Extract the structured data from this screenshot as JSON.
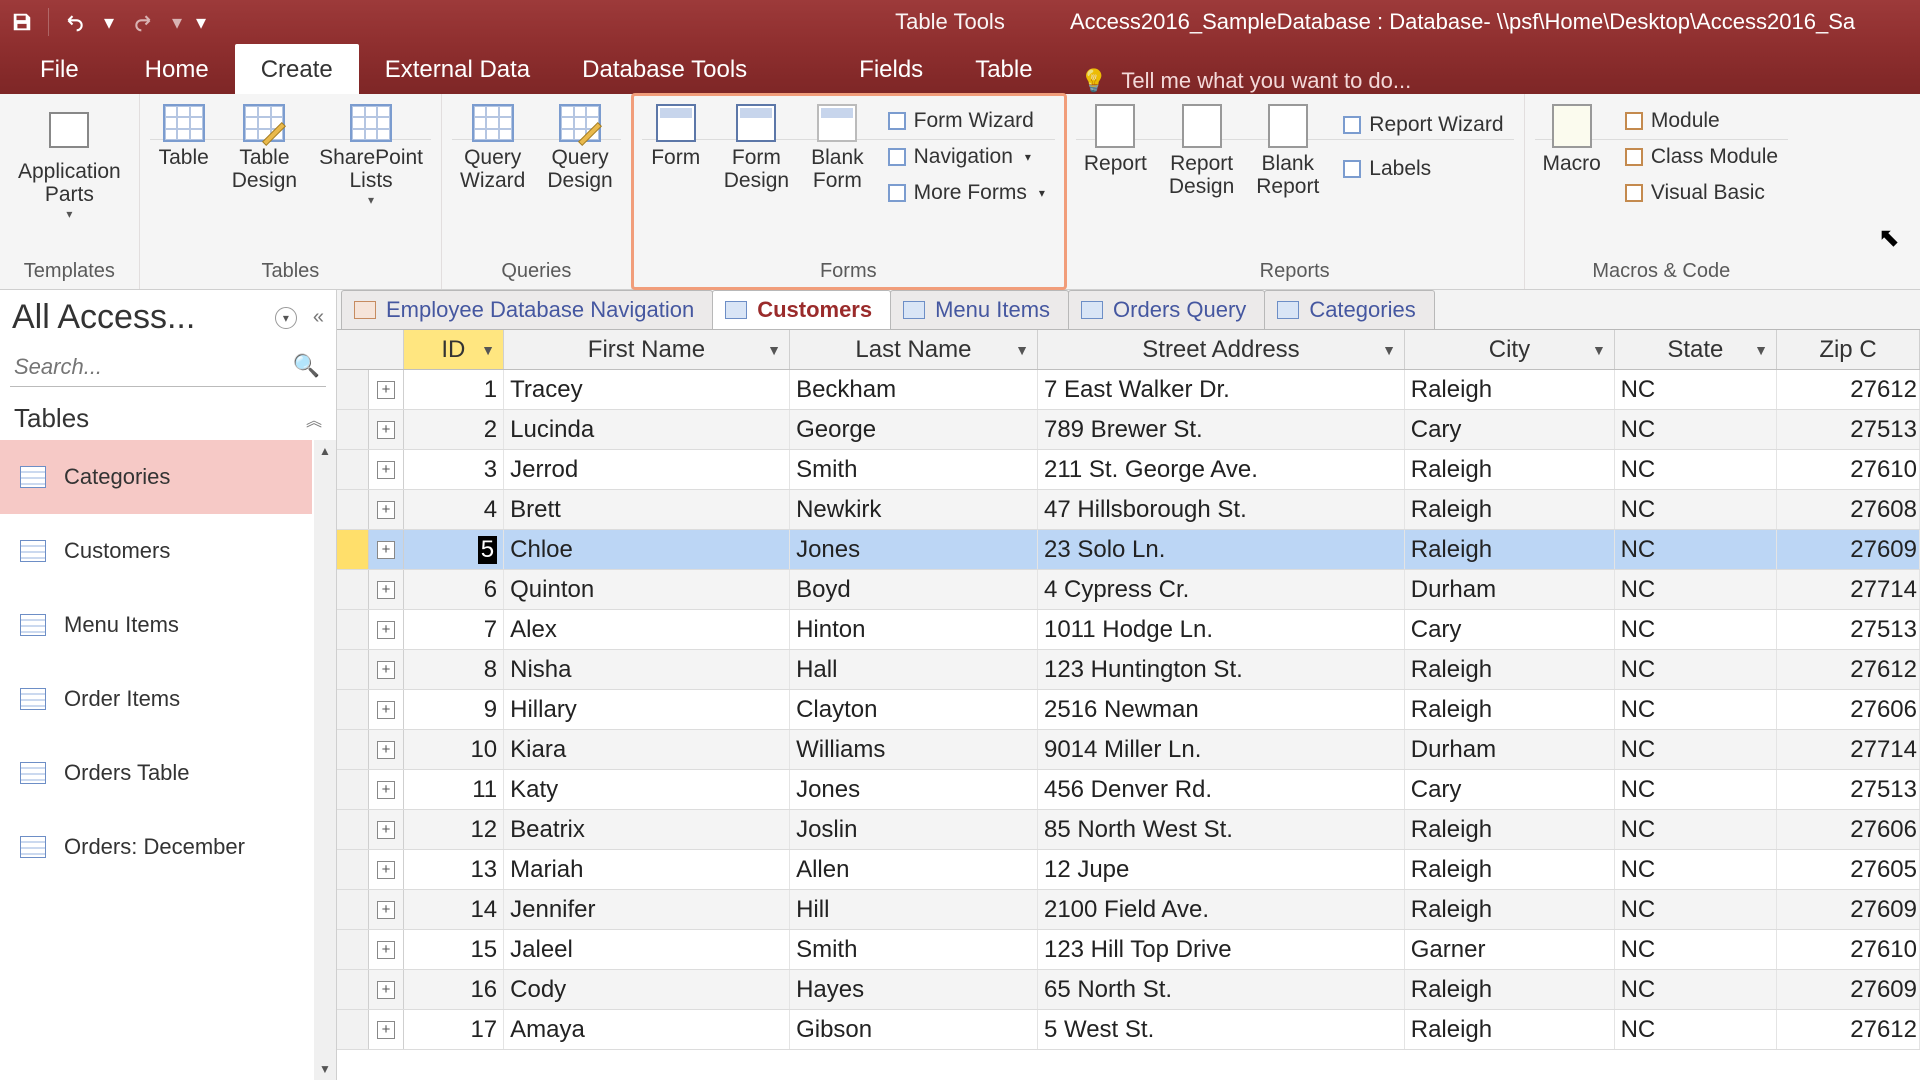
{
  "qat": {
    "contextTab": "Table Tools",
    "title": "Access2016_SampleDatabase : Database- \\\\psf\\Home\\Desktop\\Access2016_Sa"
  },
  "tabs": {
    "file": "File",
    "home": "Home",
    "create": "Create",
    "external": "External Data",
    "dbtools": "Database Tools",
    "fields": "Fields",
    "table": "Table"
  },
  "tellme": "Tell me what you want to do...",
  "ribbon": {
    "templates": {
      "appParts": "Application\nParts",
      "label": "Templates"
    },
    "tables": {
      "table": "Table",
      "tableDesign": "Table\nDesign",
      "spLists": "SharePoint\nLists",
      "label": "Tables"
    },
    "queries": {
      "wizard": "Query\nWizard",
      "design": "Query\nDesign",
      "label": "Queries"
    },
    "forms": {
      "form": "Form",
      "formDesign": "Form\nDesign",
      "blank": "Blank\nForm",
      "wizard": "Form Wizard",
      "nav": "Navigation",
      "more": "More Forms",
      "label": "Forms"
    },
    "reports": {
      "report": "Report",
      "reportDesign": "Report\nDesign",
      "blank": "Blank\nReport",
      "wizard": "Report Wizard",
      "labels": "Labels",
      "label": "Reports"
    },
    "macros": {
      "macro": "Macro",
      "module": "Module",
      "classModule": "Class Module",
      "vb": "Visual Basic",
      "label": "Macros & Code"
    }
  },
  "nav": {
    "header": "All Access...",
    "searchPlaceholder": "Search...",
    "group": "Tables",
    "items": [
      "Categories",
      "Customers",
      "Menu Items",
      "Order Items",
      "Orders Table",
      "Orders: December"
    ],
    "selected": 0
  },
  "docTabs": [
    {
      "label": "Employee Database Navigation",
      "type": "form"
    },
    {
      "label": "Customers",
      "type": "table",
      "active": true
    },
    {
      "label": "Menu Items",
      "type": "table"
    },
    {
      "label": "Orders Query",
      "type": "table"
    },
    {
      "label": "Categories",
      "type": "table"
    }
  ],
  "columns": [
    "ID",
    "First Name",
    "Last Name",
    "Street Address",
    "City",
    "State",
    "Zip C"
  ],
  "selectedRow": 4,
  "rows": [
    {
      "id": 1,
      "fn": "Tracey",
      "ln": "Beckham",
      "sa": "7 East Walker Dr.",
      "ci": "Raleigh",
      "st": "NC",
      "zp": "27612"
    },
    {
      "id": 2,
      "fn": "Lucinda",
      "ln": "George",
      "sa": "789 Brewer St.",
      "ci": "Cary",
      "st": "NC",
      "zp": "27513"
    },
    {
      "id": 3,
      "fn": "Jerrod",
      "ln": "Smith",
      "sa": "211 St. George Ave.",
      "ci": "Raleigh",
      "st": "NC",
      "zp": "27610"
    },
    {
      "id": 4,
      "fn": "Brett",
      "ln": "Newkirk",
      "sa": "47 Hillsborough St.",
      "ci": "Raleigh",
      "st": "NC",
      "zp": "27608"
    },
    {
      "id": 5,
      "fn": "Chloe",
      "ln": "Jones",
      "sa": "23 Solo Ln.",
      "ci": "Raleigh",
      "st": "NC",
      "zp": "27609"
    },
    {
      "id": 6,
      "fn": "Quinton",
      "ln": "Boyd",
      "sa": "4 Cypress Cr.",
      "ci": "Durham",
      "st": "NC",
      "zp": "27714"
    },
    {
      "id": 7,
      "fn": "Alex",
      "ln": "Hinton",
      "sa": "1011 Hodge Ln.",
      "ci": "Cary",
      "st": "NC",
      "zp": "27513"
    },
    {
      "id": 8,
      "fn": "Nisha",
      "ln": "Hall",
      "sa": "123 Huntington St.",
      "ci": "Raleigh",
      "st": "NC",
      "zp": "27612"
    },
    {
      "id": 9,
      "fn": "Hillary",
      "ln": "Clayton",
      "sa": "2516 Newman",
      "ci": "Raleigh",
      "st": "NC",
      "zp": "27606"
    },
    {
      "id": 10,
      "fn": "Kiara",
      "ln": "Williams",
      "sa": "9014 Miller Ln.",
      "ci": "Durham",
      "st": "NC",
      "zp": "27714"
    },
    {
      "id": 11,
      "fn": "Katy",
      "ln": "Jones",
      "sa": "456 Denver Rd.",
      "ci": "Cary",
      "st": "NC",
      "zp": "27513"
    },
    {
      "id": 12,
      "fn": "Beatrix",
      "ln": "Joslin",
      "sa": "85 North West St.",
      "ci": "Raleigh",
      "st": "NC",
      "zp": "27606"
    },
    {
      "id": 13,
      "fn": "Mariah",
      "ln": "Allen",
      "sa": "12 Jupe",
      "ci": "Raleigh",
      "st": "NC",
      "zp": "27605"
    },
    {
      "id": 14,
      "fn": "Jennifer",
      "ln": "Hill",
      "sa": "2100 Field Ave.",
      "ci": "Raleigh",
      "st": "NC",
      "zp": "27609"
    },
    {
      "id": 15,
      "fn": "Jaleel",
      "ln": "Smith",
      "sa": "123 Hill Top Drive",
      "ci": "Garner",
      "st": "NC",
      "zp": "27610"
    },
    {
      "id": 16,
      "fn": "Cody",
      "ln": "Hayes",
      "sa": "65 North St.",
      "ci": "Raleigh",
      "st": "NC",
      "zp": "27609"
    },
    {
      "id": 17,
      "fn": "Amaya",
      "ln": "Gibson",
      "sa": "5 West St.",
      "ci": "Raleigh",
      "st": "NC",
      "zp": "27612"
    }
  ]
}
